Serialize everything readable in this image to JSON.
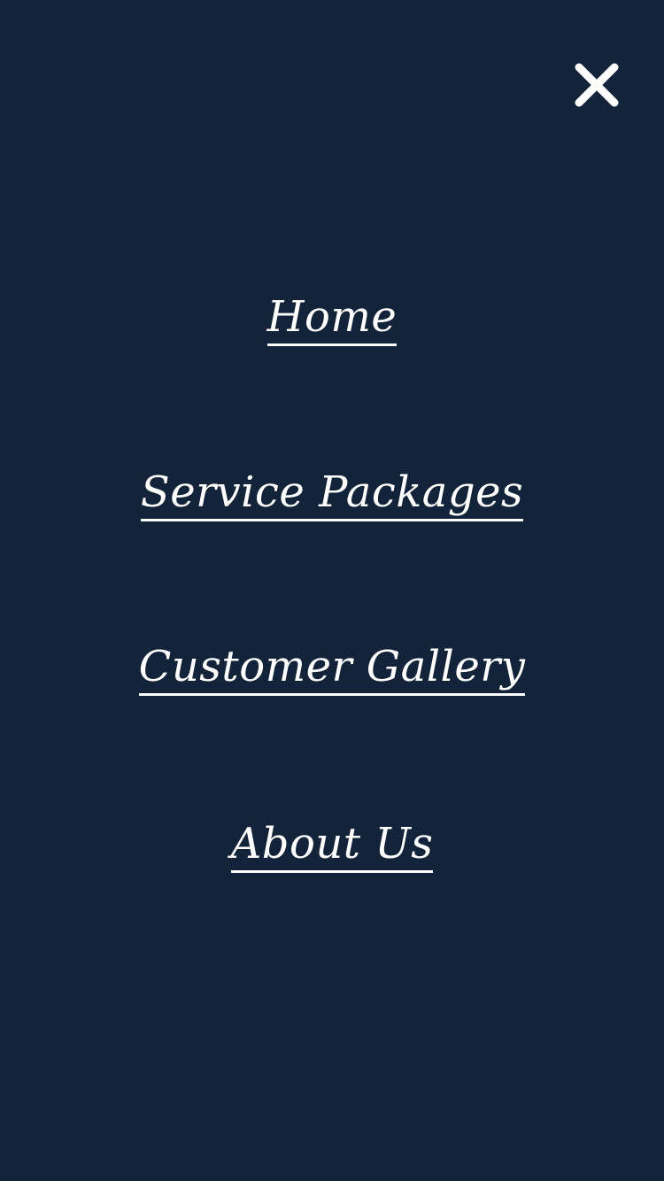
{
  "colors": {
    "background": "#13233a",
    "text": "#ffffff"
  },
  "close_button": {
    "icon": "close-icon"
  },
  "nav": {
    "items": [
      {
        "label": "Home"
      },
      {
        "label": "Service Packages"
      },
      {
        "label": "Customer Gallery"
      },
      {
        "label": "About Us"
      }
    ]
  }
}
